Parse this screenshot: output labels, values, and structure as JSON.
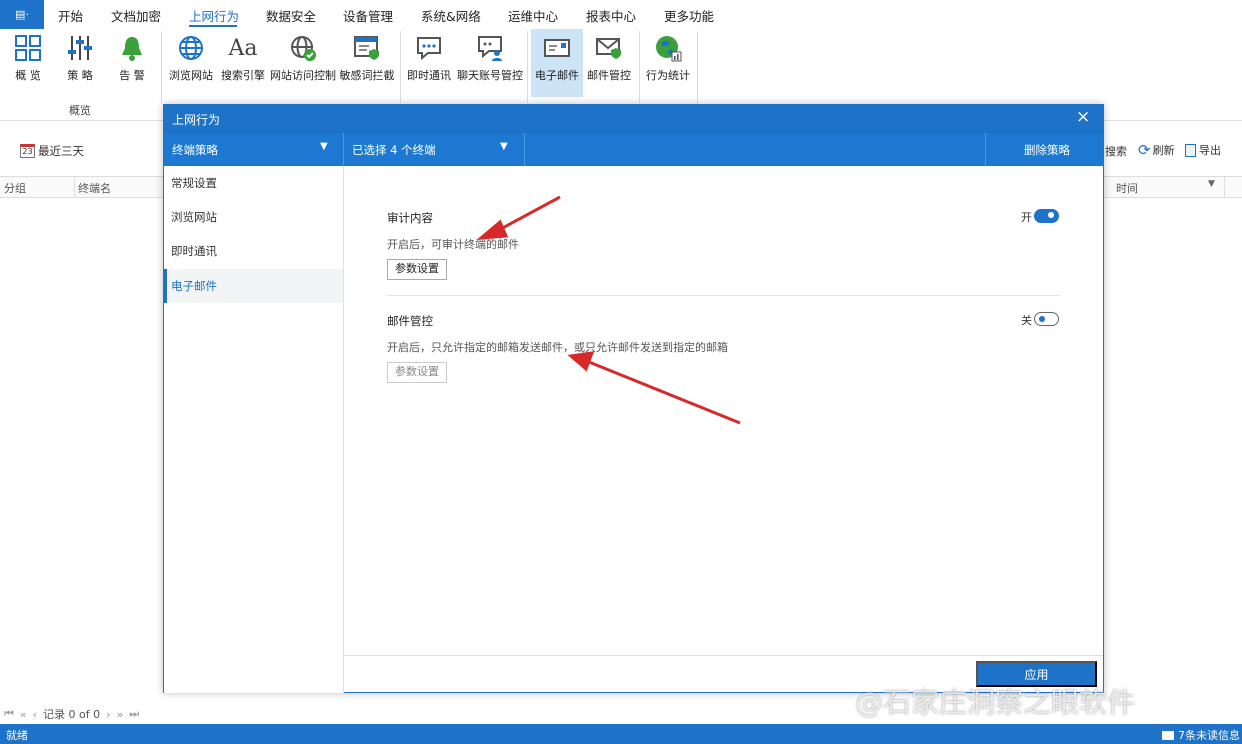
{
  "menubar": {
    "app_button": "▤·",
    "items": [
      "开始",
      "文档加密",
      "上网行为",
      "数据安全",
      "设备管理",
      "系统&网络",
      "运维中心",
      "报表中心",
      "更多功能"
    ]
  },
  "ribbon": {
    "buttons": [
      {
        "label": "概 览",
        "icon": "grid-icon"
      },
      {
        "label": "策 略",
        "icon": "sliders-icon"
      },
      {
        "label": "告 警",
        "icon": "bell-icon"
      },
      {
        "label": "浏览网站",
        "icon": "globe-icon"
      },
      {
        "label": "搜索引擎",
        "icon": "font-icon"
      },
      {
        "label": "网站访问控制",
        "icon": "globe-check-icon"
      },
      {
        "label": "敏感词拦截",
        "icon": "window-shield-icon"
      },
      {
        "label": "即时通讯",
        "icon": "chat-icon"
      },
      {
        "label": "聊天账号管控",
        "icon": "chat-user-icon"
      },
      {
        "label": "电子邮件",
        "icon": "mail-icon"
      },
      {
        "label": "邮件管控",
        "icon": "mail-shield-icon"
      },
      {
        "label": "行为统计",
        "icon": "earth-chart-icon"
      }
    ],
    "group_label": "概览"
  },
  "background": {
    "date_filter": "最近三天",
    "date_badge": "23",
    "search": "搜索",
    "refresh": "刷新",
    "export": "导出",
    "columns": [
      "分组",
      "终端名",
      "时间"
    ],
    "pager_record": "记录 0 of 0"
  },
  "dialog": {
    "title": "上网行为",
    "close": "×",
    "policy_select": "终端策略",
    "terminal_select": "已选择 4 个终端",
    "delete_policy": "删除策略",
    "sidebar": [
      "常规设置",
      "浏览网站",
      "即时通讯",
      "电子邮件"
    ],
    "features": [
      {
        "title": "审计内容",
        "desc": "开启后，可审计终端的邮件",
        "state_label": "开",
        "enabled": true,
        "button": "参数设置"
      },
      {
        "title": "邮件管控",
        "desc": "开启后，只允许指定的邮箱发送邮件，或只允许邮件发送到指定的邮箱",
        "state_label": "关",
        "enabled": false,
        "button": "参数设置"
      }
    ],
    "apply": "应用"
  },
  "statusbar": {
    "left": "就绪",
    "right": "7条未读信息"
  },
  "watermark": "@石家庄洞察之眼软件",
  "colors": {
    "accent": "#1e72c8",
    "arrow": "#d62a2a"
  }
}
